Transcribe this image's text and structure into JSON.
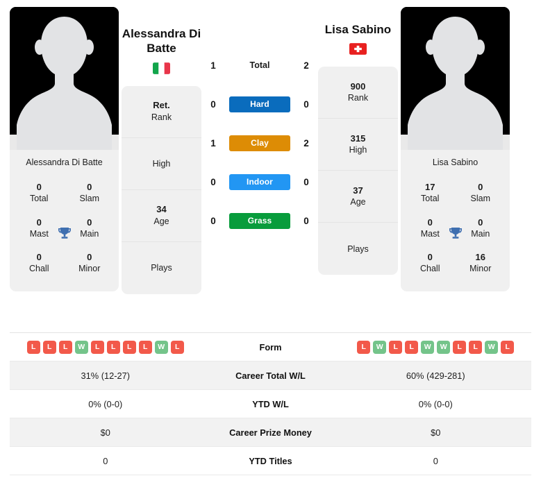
{
  "players": {
    "left": {
      "name": "Alessandra Di Batte",
      "name_display": "Alessandra Di Batte",
      "country": "Italy",
      "flag_icon": "flag-italy",
      "photo_caption": "Alessandra Di Batte",
      "info": [
        {
          "value": "Ret.",
          "label": "Rank"
        },
        {
          "value": "",
          "label": "High"
        },
        {
          "value": "34",
          "label": "Age"
        },
        {
          "value": "",
          "label": "Plays"
        }
      ],
      "titles": [
        {
          "value": "0",
          "label": "Total"
        },
        {
          "value": "0",
          "label": "Slam"
        },
        {
          "value": "0",
          "label": "Mast"
        },
        {
          "value": "0",
          "label": "Main"
        },
        {
          "value": "0",
          "label": "Chall"
        },
        {
          "value": "0",
          "label": "Minor"
        }
      ],
      "form": [
        "L",
        "L",
        "L",
        "W",
        "L",
        "L",
        "L",
        "L",
        "W",
        "L"
      ],
      "stats": {
        "career_total_wl": "31% (12-27)",
        "ytd_wl": "0% (0-0)",
        "career_prize_money": "$0",
        "ytd_titles": "0"
      }
    },
    "right": {
      "name": "Lisa Sabino",
      "name_display": "Lisa Sabino",
      "country": "Switzerland",
      "flag_icon": "flag-switzerland",
      "photo_caption": "Lisa Sabino",
      "info": [
        {
          "value": "900",
          "label": "Rank"
        },
        {
          "value": "315",
          "label": "High"
        },
        {
          "value": "37",
          "label": "Age"
        },
        {
          "value": "",
          "label": "Plays"
        }
      ],
      "titles": [
        {
          "value": "17",
          "label": "Total"
        },
        {
          "value": "0",
          "label": "Slam"
        },
        {
          "value": "0",
          "label": "Mast"
        },
        {
          "value": "0",
          "label": "Main"
        },
        {
          "value": "0",
          "label": "Chall"
        },
        {
          "value": "16",
          "label": "Minor"
        }
      ],
      "form": [
        "L",
        "W",
        "L",
        "L",
        "W",
        "W",
        "L",
        "L",
        "W",
        "L"
      ],
      "stats": {
        "career_total_wl": "60% (429-281)",
        "ytd_wl": "0% (0-0)",
        "career_prize_money": "$0",
        "ytd_titles": "0"
      }
    }
  },
  "head_to_head": [
    {
      "label": "Total",
      "left": "1",
      "right": "2",
      "type": "total",
      "color": ""
    },
    {
      "label": "Hard",
      "left": "0",
      "right": "0",
      "type": "surface",
      "color": "#0a6cbd"
    },
    {
      "label": "Clay",
      "left": "1",
      "right": "2",
      "type": "surface",
      "color": "#dd8c05"
    },
    {
      "label": "Indoor",
      "left": "0",
      "right": "0",
      "type": "surface",
      "color": "#2296f3"
    },
    {
      "label": "Grass",
      "left": "0",
      "right": "0",
      "type": "surface",
      "color": "#089c3c"
    }
  ],
  "table_rows": [
    {
      "label": "Form",
      "left": "",
      "right": "",
      "kind": "form",
      "shaded": false
    },
    {
      "label": "Career Total W/L",
      "left": "31% (12-27)",
      "right": "60% (429-281)",
      "kind": "text",
      "shaded": true
    },
    {
      "label": "YTD W/L",
      "left": "0% (0-0)",
      "right": "0% (0-0)",
      "kind": "text",
      "shaded": false
    },
    {
      "label": "Career Prize Money",
      "left": "$0",
      "right": "$0",
      "kind": "text",
      "shaded": true
    },
    {
      "label": "YTD Titles",
      "left": "0",
      "right": "0",
      "kind": "text",
      "shaded": false
    }
  ],
  "icons": {
    "trophy": "trophy-icon",
    "avatar": "player-avatar-placeholder"
  },
  "colors": {
    "hard": "#0a6cbd",
    "clay": "#dd8c05",
    "indoor": "#2296f3",
    "grass": "#089c3c",
    "win": "#74c48a",
    "loss": "#f2594a",
    "trophy": "#3f6fb0",
    "card_bg": "#f0f0f0"
  }
}
